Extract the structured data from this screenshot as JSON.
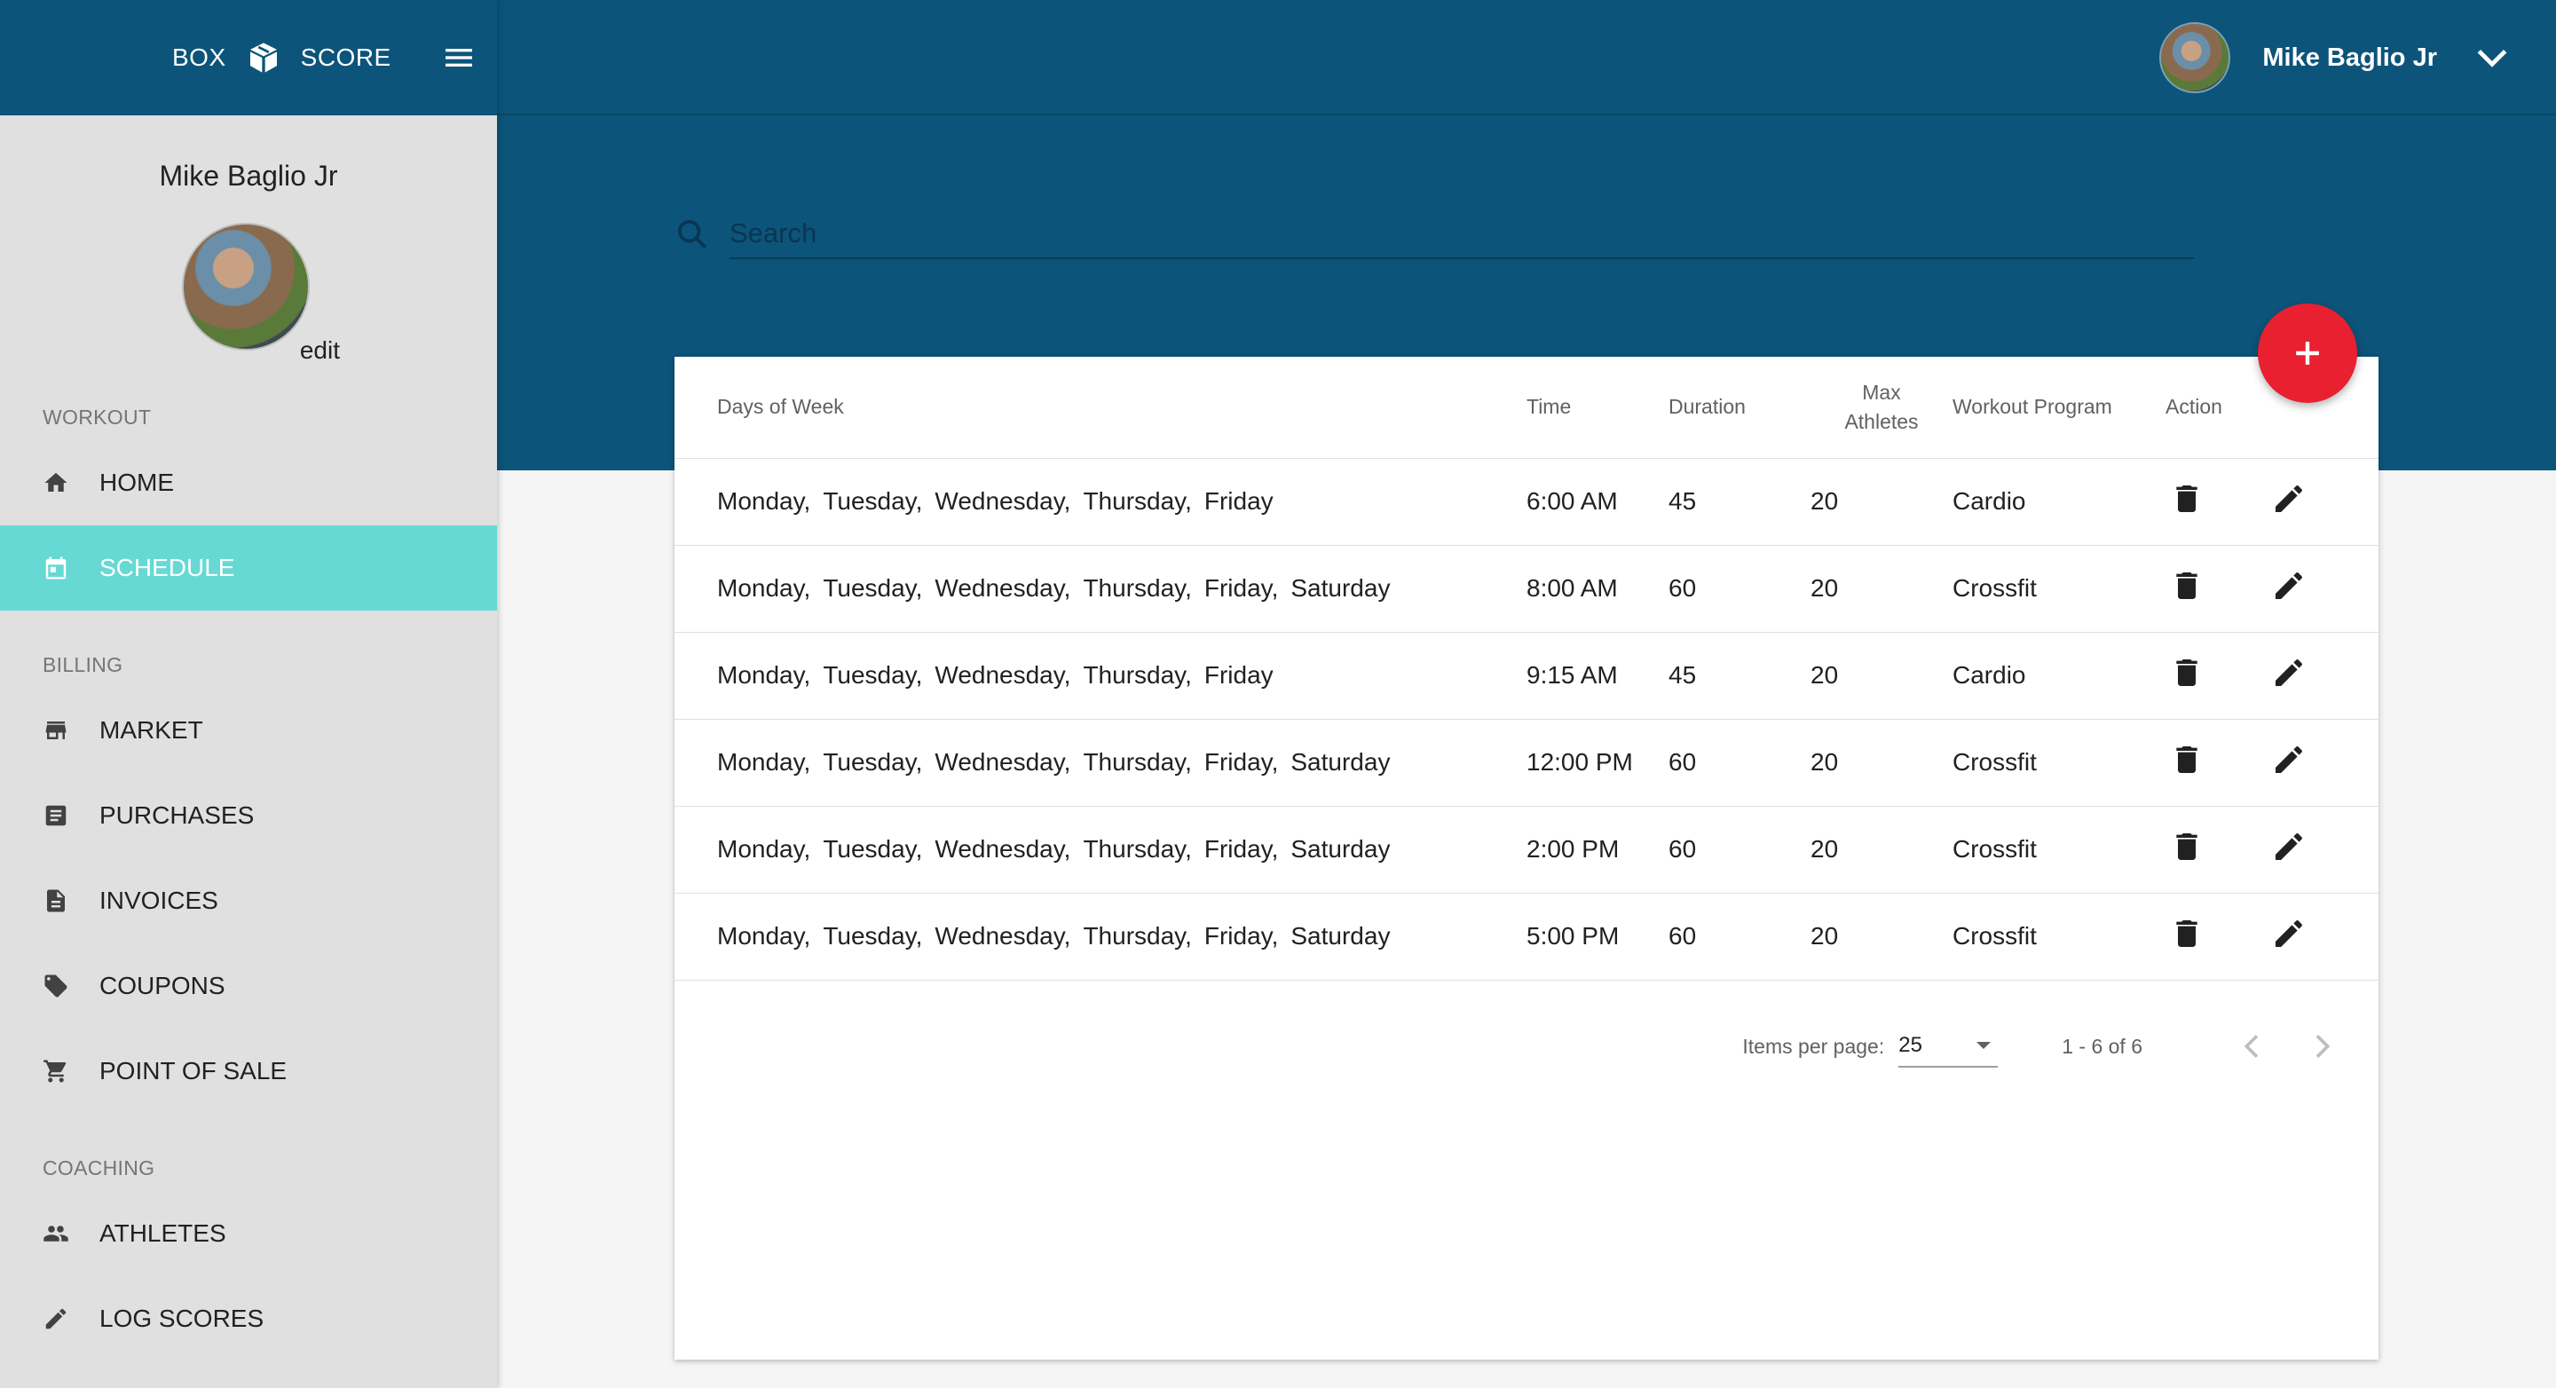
{
  "brand": {
    "left": "BOX",
    "right": "SCORE"
  },
  "user": {
    "name": "Mike Baglio Jr",
    "edit_label": "edit"
  },
  "sidebar": {
    "sections": [
      {
        "label": "WORKOUT",
        "items": [
          {
            "label": "HOME",
            "icon": "home-icon"
          },
          {
            "label": "SCHEDULE",
            "icon": "calendar-icon",
            "active": true
          }
        ]
      },
      {
        "label": "BILLING",
        "items": [
          {
            "label": "MARKET",
            "icon": "store-icon"
          },
          {
            "label": "PURCHASES",
            "icon": "list-icon"
          },
          {
            "label": "INVOICES",
            "icon": "document-icon"
          },
          {
            "label": "COUPONS",
            "icon": "tag-icon"
          },
          {
            "label": "POINT OF SALE",
            "icon": "cart-icon"
          }
        ]
      },
      {
        "label": "COACHING",
        "items": [
          {
            "label": "ATHLETES",
            "icon": "people-icon"
          },
          {
            "label": "LOG SCORES",
            "icon": "pencil-icon"
          }
        ]
      }
    ]
  },
  "search": {
    "placeholder": "Search"
  },
  "table": {
    "headers": {
      "days": "Days of Week",
      "time": "Time",
      "duration": "Duration",
      "max_line1": "Max",
      "max_line2": "Athletes",
      "program": "Workout Program",
      "action": "Action"
    },
    "rows": [
      {
        "days": [
          "Monday,",
          "Tuesday,",
          "Wednesday,",
          "Thursday,",
          "Friday"
        ],
        "time": "6:00 AM",
        "duration": "45",
        "max": "20",
        "program": "Cardio"
      },
      {
        "days": [
          "Monday,",
          "Tuesday,",
          "Wednesday,",
          "Thursday,",
          "Friday,",
          "Saturday"
        ],
        "time": "8:00 AM",
        "duration": "60",
        "max": "20",
        "program": "Crossfit"
      },
      {
        "days": [
          "Monday,",
          "Tuesday,",
          "Wednesday,",
          "Thursday,",
          "Friday"
        ],
        "time": "9:15 AM",
        "duration": "45",
        "max": "20",
        "program": "Cardio"
      },
      {
        "days": [
          "Monday,",
          "Tuesday,",
          "Wednesday,",
          "Thursday,",
          "Friday,",
          "Saturday"
        ],
        "time": "12:00 PM",
        "duration": "60",
        "max": "20",
        "program": "Crossfit"
      },
      {
        "days": [
          "Monday,",
          "Tuesday,",
          "Wednesday,",
          "Thursday,",
          "Friday,",
          "Saturday"
        ],
        "time": "2:00 PM",
        "duration": "60",
        "max": "20",
        "program": "Crossfit"
      },
      {
        "days": [
          "Monday,",
          "Tuesday,",
          "Wednesday,",
          "Thursday,",
          "Friday,",
          "Saturday"
        ],
        "time": "5:00 PM",
        "duration": "60",
        "max": "20",
        "program": "Crossfit"
      }
    ]
  },
  "paginator": {
    "items_label": "Items per page:",
    "page_size": "25",
    "range": "1 - 6 of 6"
  },
  "colors": {
    "primary": "#0c5479",
    "accent": "#66d9d4",
    "fab": "#e8202f",
    "sidebar_bg": "#e0e0e0"
  }
}
